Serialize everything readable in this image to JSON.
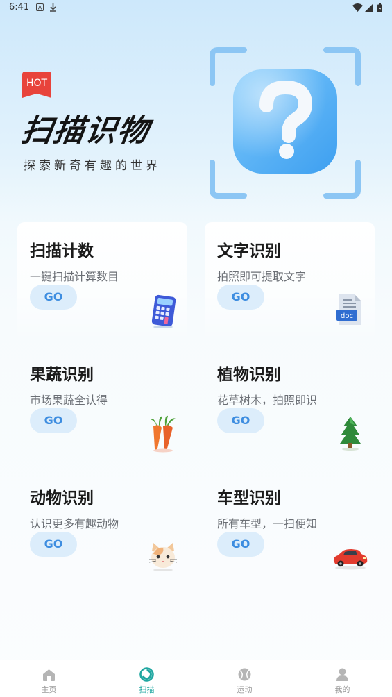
{
  "status_bar": {
    "time": "6:41",
    "icons": [
      "a-notification-icon",
      "download-icon",
      "wifi-icon",
      "signal-icon",
      "battery-icon"
    ]
  },
  "hero": {
    "badge": "HOT",
    "title": "扫描识物",
    "subtitle": "探索新奇有趣的世界",
    "art_icon": "question-scan-icon"
  },
  "cards": [
    {
      "title": "扫描计数",
      "desc": "一键扫描计算数目",
      "button": "GO",
      "icon": "calculator-icon"
    },
    {
      "title": "文字识别",
      "desc": "拍照即可提取文字",
      "button": "GO",
      "icon": "doc-file-icon"
    },
    {
      "title": "果蔬识别",
      "desc": "市场果蔬全认得",
      "button": "GO",
      "icon": "carrot-icon"
    },
    {
      "title": "植物识别",
      "desc": "花草树木，拍照即识",
      "button": "GO",
      "icon": "tree-icon"
    },
    {
      "title": "动物识别",
      "desc": "认识更多有趣动物",
      "button": "GO",
      "icon": "cat-icon"
    },
    {
      "title": "车型识别",
      "desc": "所有车型，一扫便知",
      "button": "GO",
      "icon": "car-icon"
    }
  ],
  "bottom_nav": {
    "items": [
      {
        "label": "主页",
        "icon": "home-icon"
      },
      {
        "label": "扫描",
        "icon": "scan-icon"
      },
      {
        "label": "运动",
        "icon": "ball-icon"
      },
      {
        "label": "我的",
        "icon": "profile-icon"
      }
    ],
    "active_index": 1
  },
  "colors": {
    "accent_blue": "#3d8de0",
    "go_bg": "#dcedfb",
    "nav_active": "#20a7a1",
    "hot_red": "#e8433b"
  }
}
